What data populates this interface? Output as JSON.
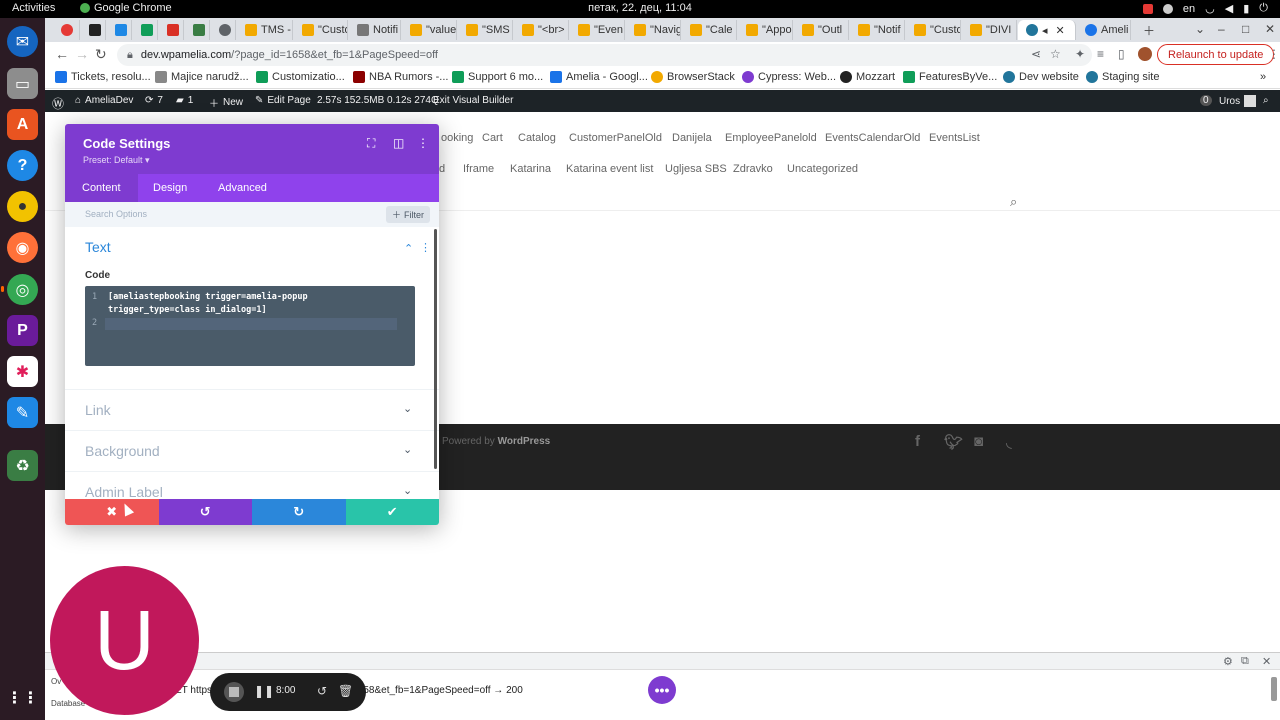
{
  "gnome": {
    "activities": "Activities",
    "app_name": "Google Chrome",
    "clock": "петак, 22. дец, 11:04",
    "lang": "en"
  },
  "tabs": [
    {
      "label": "",
      "color": "#e53935"
    },
    {
      "label": "",
      "color": "#222222"
    },
    {
      "label": "",
      "color": "#1e88e5"
    },
    {
      "label": "",
      "color": "#0f9d58"
    },
    {
      "label": "",
      "color": "#d93025"
    },
    {
      "label": "",
      "color": "#3a7d44"
    },
    {
      "label": "",
      "color": "#5f6368"
    },
    {
      "label": "TMS -",
      "color": "#f2a900"
    },
    {
      "label": "\"Custo",
      "color": "#f2a900"
    },
    {
      "label": "Notifi",
      "color": "#777777"
    },
    {
      "label": "\"value",
      "color": "#f2a900"
    },
    {
      "label": "\"SMS",
      "color": "#f2a900"
    },
    {
      "label": "\"<br>",
      "color": "#f2a900"
    },
    {
      "label": "\"Even",
      "color": "#f2a900"
    },
    {
      "label": "\"Navig",
      "color": "#f2a900"
    },
    {
      "label": "\"Cale",
      "color": "#f2a900"
    },
    {
      "label": "\"Appo",
      "color": "#f2a900"
    },
    {
      "label": "\"Outl",
      "color": "#f2a900"
    },
    {
      "label": "\"Notif",
      "color": "#f2a900"
    },
    {
      "label": "\"Custo",
      "color": "#f2a900"
    },
    {
      "label": "\"DIVI",
      "color": "#f2a900"
    },
    {
      "label": "",
      "color": "#21759b"
    },
    {
      "label": "Ameli",
      "color": "#1a73e8"
    }
  ],
  "toolbar": {
    "url_host": "dev.wpamelia.com",
    "url_path": "/?page_id=1658&et_fb=1&PageSpeed=off",
    "relaunch": "Relaunch to update"
  },
  "bookmarks": [
    {
      "label": "Tickets, resolu...",
      "color": "#1a73e8"
    },
    {
      "label": "Majice narudž...",
      "color": "#888888"
    },
    {
      "label": "Customizatio...",
      "color": "#0f9d58"
    },
    {
      "label": "NBA Rumors -...",
      "color": "#8b0000"
    },
    {
      "label": "Support 6 mo...",
      "color": "#0f9d58"
    },
    {
      "label": "Amelia - Googl...",
      "color": "#1a73e8"
    },
    {
      "label": "BrowserStack",
      "color": "#f2a900"
    },
    {
      "label": "Cypress: Web...",
      "color": "#7e3bd0"
    },
    {
      "label": "Mozzart",
      "color": "#222222"
    },
    {
      "label": "FeaturesByVe...",
      "color": "#0f9d58"
    },
    {
      "label": "Dev website",
      "color": "#21759b"
    },
    {
      "label": "Staging site",
      "color": "#21759b"
    }
  ],
  "wpbar": {
    "site": "AmeliaDev",
    "updates": "7",
    "comments": "1",
    "new": "New",
    "edit": "Edit Page",
    "stats": "2.57s  152.5MB  0.12s  274Q",
    "exit": "Exit Visual Builder",
    "notif": "0",
    "user": "Uros"
  },
  "menu": {
    "row1": [
      "ooking",
      "Cart",
      "Catalog",
      "CustomerPanelOld",
      "Danijela",
      "EmployeePanelold",
      "EventsCalendarOld",
      "EventsList"
    ],
    "row2": [
      "d",
      "Iframe",
      "Katarina",
      "Katarina event list",
      "Ugljesa SBS",
      "Zdravko",
      "Uncategorized"
    ]
  },
  "footer": {
    "credit_prefix": "Powered by",
    "credit_brand": "WordPress",
    "social": [
      "f",
      "t",
      "o",
      "rss"
    ]
  },
  "modal": {
    "title": "Code Settings",
    "preset": "Preset: Default ▾",
    "tabs": [
      "Content",
      "Design",
      "Advanced"
    ],
    "search_placeholder": "Search Options",
    "filter": "Filter",
    "section_text": "Text",
    "code_label": "Code",
    "code_line_numbers": [
      "1",
      "2"
    ],
    "code_line1": "[ameliastepbooking trigger=amelia-popup",
    "code_line1_wrap": "trigger_type=class in_dialog=1]",
    "sections": [
      "Link",
      "Background",
      "Admin Label"
    ],
    "footer_buttons": [
      {
        "name": "discard",
        "symbol": "✖",
        "color": "#ef5555"
      },
      {
        "name": "undo",
        "symbol": "↺",
        "color": "#7e3bd0"
      },
      {
        "name": "redo",
        "symbol": "↻",
        "color": "#2b87da"
      },
      {
        "name": "save",
        "symbol": "✔",
        "color": "#29c4a9"
      }
    ],
    "colors": {
      "header": "#7e3bd0",
      "tabs": "#8f42ec",
      "accent": "#2b87da"
    }
  },
  "devtools": {
    "log": "ET https://dev.wpamelia.com/?page_id=1658&et_fb=1&PageSpeed=off → 200",
    "side": [
      "Ov",
      "Database"
    ]
  },
  "recorder": {
    "avatar_letter": "U",
    "time": "8:00"
  }
}
